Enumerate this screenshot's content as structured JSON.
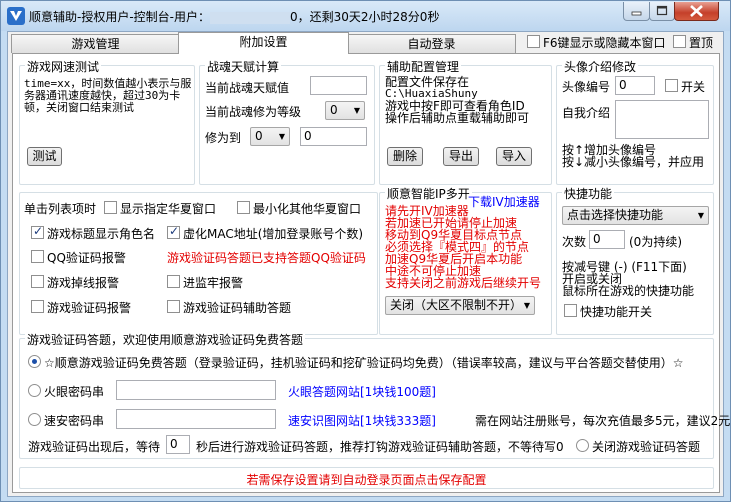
{
  "window": {
    "title_prefix": "顺意辅助-授权用户-控制台-用户：",
    "title_suffix": "0，还剩30天2小时28分0秒"
  },
  "tabs": [
    "游戏管理",
    "附加设置",
    "自动登录"
  ],
  "top_options": {
    "f6_label": "F6键显示或隐藏本窗口",
    "pin_label": "置顶"
  },
  "speed_test": {
    "title": "游戏网速测试",
    "description": "time=xx，时间数值越小表示与服务器通讯速度越快，超过30为卡顿，关闭窗口结束测试",
    "button": "测试"
  },
  "battle": {
    "title": "战魂天赋计算",
    "current_value_label": "当前战魂天赋值",
    "current_level_label": "当前战魂修为等级",
    "level_select": "0",
    "target_label": "修为到",
    "target_select": "0",
    "target_value": "0"
  },
  "aux_config": {
    "title": "辅助配置管理",
    "line1": "配置文件保存在",
    "path": "C:\\HuaxiaShuny",
    "line3": "游戏中按F即可查看角色ID",
    "line4": "操作后辅助点重载辅助即可",
    "buttons": [
      "删除",
      "导出",
      "导入"
    ]
  },
  "avatar": {
    "title": "头像介绍修改",
    "number_label": "头像编号",
    "number_value": "0",
    "switch_label": "开关",
    "intro_label": "自我介绍",
    "hint1": "按↑增加头像编号",
    "hint2": "按↓减小头像编号，并应用"
  },
  "options": {
    "single_click_label": "单击列表项时",
    "items": [
      {
        "label": "显示指定华夏窗口",
        "checked": false
      },
      {
        "label": "最小化其他华夏窗口",
        "checked": false
      },
      {
        "label": "游戏标题显示角色名",
        "checked": true
      },
      {
        "label": "虚化MAC地址(增加登录账号个数)",
        "checked": true
      },
      {
        "label": "QQ验证码报警",
        "checked": false
      },
      {
        "label": "游戏掉线报警",
        "checked": false
      },
      {
        "label": "进监牢报警",
        "checked": false
      },
      {
        "label": "游戏验证码报警",
        "checked": false
      },
      {
        "label": "游戏验证码辅助答题",
        "checked": false
      }
    ],
    "red_note": "游戏验证码答题已支持答题QQ验证码"
  },
  "multi": {
    "title": "顺意智能IP多开",
    "download_link": "下载IV加速器",
    "lines": [
      "请先开IV加速器",
      "若加速已开始请停止加速",
      "移动到Q9华夏目标点节点",
      "必须选择『模式四』的节点",
      "加速Q9华夏后开启本功能",
      "中途不可停止加速",
      "支持关闭之前游戏后继续开号"
    ],
    "select": "关闭（大区不限制不开）"
  },
  "shortcut": {
    "title": "快捷功能",
    "select": "点击选择快捷功能",
    "count_label": "次数",
    "count_value": "0",
    "count_hint": "(0为持续)",
    "hint1": "按减号键 (-) (F11下面)",
    "hint2": "开启或关闭",
    "hint3": "鼠标所在游戏的快捷功能",
    "switch_label": "快捷功能开关"
  },
  "captcha": {
    "title": "游戏验证码答题，欢迎使用顺意游戏验证码免费答题",
    "free_option": "☆顺意游戏验证码免费答题（登录验证码，挂机验证码和挖矿验证码均免费）（错误率较高，建议与平台答题交替使用）☆",
    "huoyan_label": "火眼密码串",
    "huoyan_link": "火眼答题网站[1块钱100题]",
    "suan_label": "速安密码串",
    "suan_link": "速安识图网站[1块钱333题]",
    "suan_note": "需在网站注册账号，每次充值最多5元，建议2元",
    "wait_prefix": "游戏验证码出现后，等待",
    "wait_value": "0",
    "wait_suffix": "秒后进行游戏验证码答题，推荐打钩游戏验证码辅助答题，不等待写0",
    "close_option": "关闭游戏验证码答题"
  },
  "footer_note": "若需保存设置请到自动登录页面点击保存配置"
}
